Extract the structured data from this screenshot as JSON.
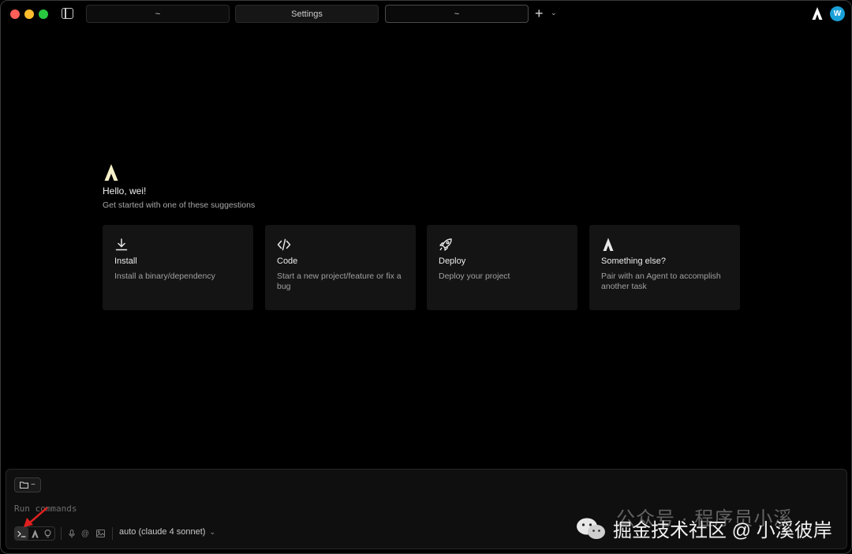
{
  "titlebar": {
    "tabs": [
      {
        "label": "~"
      },
      {
        "label": "Settings"
      },
      {
        "label": "~"
      }
    ],
    "new_tab": "+",
    "avatar_initial": "W"
  },
  "welcome": {
    "greeting": "Hello, wei!",
    "subtitle": "Get started with one of these suggestions"
  },
  "cards": [
    {
      "icon": "download-icon",
      "title": "Install",
      "desc": "Install a binary/dependency"
    },
    {
      "icon": "code-icon",
      "title": "Code",
      "desc": "Start a new project/feature or fix a bug"
    },
    {
      "icon": "rocket-icon",
      "title": "Deploy",
      "desc": "Deploy your project"
    },
    {
      "icon": "agent-logo-icon",
      "title": "Something else?",
      "desc": "Pair with an Agent to accomplish another task"
    }
  ],
  "panel": {
    "dir_chip": "~",
    "input_placeholder": "Run commands",
    "model": "auto (claude 4 sonnet)"
  },
  "watermark": {
    "line1": "公众号 · 程序员小溪",
    "line2": "掘金技术社区 @ 小溪彼岸"
  },
  "colors": {
    "background": "#000000",
    "card": "#141414",
    "avatar": "#1aa0d8",
    "logo": "#f5f0c8",
    "arrow": "#e02020"
  }
}
